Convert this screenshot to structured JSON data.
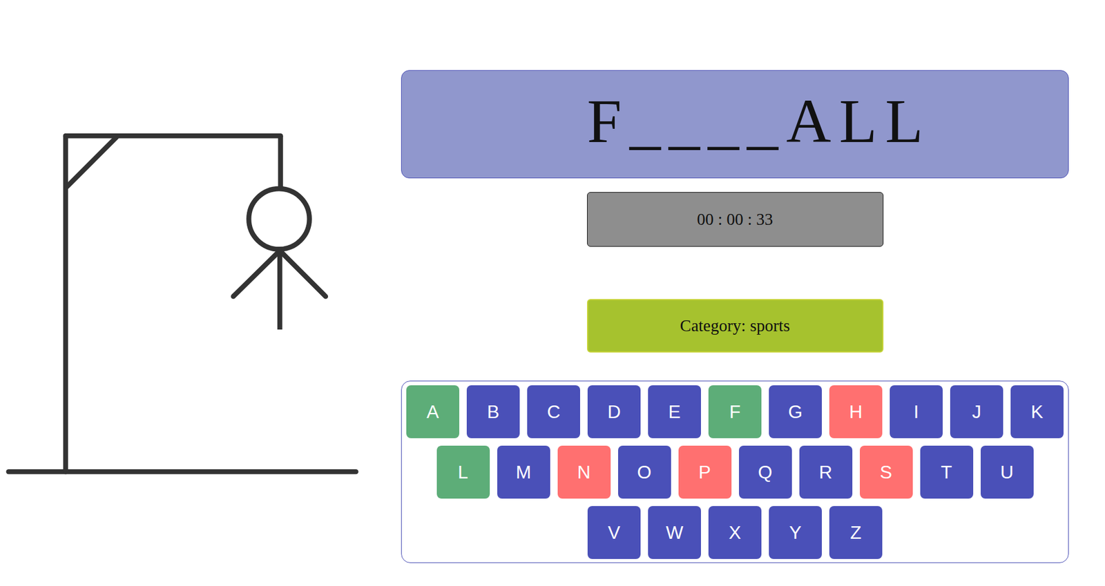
{
  "word": [
    "F",
    "_",
    "_",
    "_",
    "_",
    "A",
    "L",
    "L"
  ],
  "timer": "00 : 00 : 33",
  "category": "Category: sports",
  "hangman": {
    "parts_shown": 4
  },
  "keyboard": [
    [
      {
        "label": "A",
        "guessed": true,
        "correct": true
      },
      {
        "label": "B",
        "guessed": false,
        "correct": false
      },
      {
        "label": "C",
        "guessed": false,
        "correct": false
      },
      {
        "label": "D",
        "guessed": false,
        "correct": false
      },
      {
        "label": "E",
        "guessed": false,
        "correct": false
      },
      {
        "label": "F",
        "guessed": true,
        "correct": true
      },
      {
        "label": "G",
        "guessed": false,
        "correct": false
      },
      {
        "label": "H",
        "guessed": true,
        "correct": false
      },
      {
        "label": "I",
        "guessed": false,
        "correct": false
      },
      {
        "label": "J",
        "guessed": false,
        "correct": false
      },
      {
        "label": "K",
        "guessed": false,
        "correct": false
      }
    ],
    [
      {
        "label": "L",
        "guessed": true,
        "correct": true
      },
      {
        "label": "M",
        "guessed": false,
        "correct": false
      },
      {
        "label": "N",
        "guessed": true,
        "correct": false
      },
      {
        "label": "O",
        "guessed": false,
        "correct": false
      },
      {
        "label": "P",
        "guessed": true,
        "correct": false
      },
      {
        "label": "Q",
        "guessed": false,
        "correct": false
      },
      {
        "label": "R",
        "guessed": false,
        "correct": false
      },
      {
        "label": "S",
        "guessed": true,
        "correct": false
      },
      {
        "label": "T",
        "guessed": false,
        "correct": false
      },
      {
        "label": "U",
        "guessed": false,
        "correct": false
      }
    ],
    [
      {
        "label": "V",
        "guessed": false,
        "correct": false
      },
      {
        "label": "W",
        "guessed": false,
        "correct": false
      },
      {
        "label": "X",
        "guessed": false,
        "correct": false
      },
      {
        "label": "Y",
        "guessed": false,
        "correct": false
      },
      {
        "label": "Z",
        "guessed": false,
        "correct": false
      }
    ]
  ]
}
